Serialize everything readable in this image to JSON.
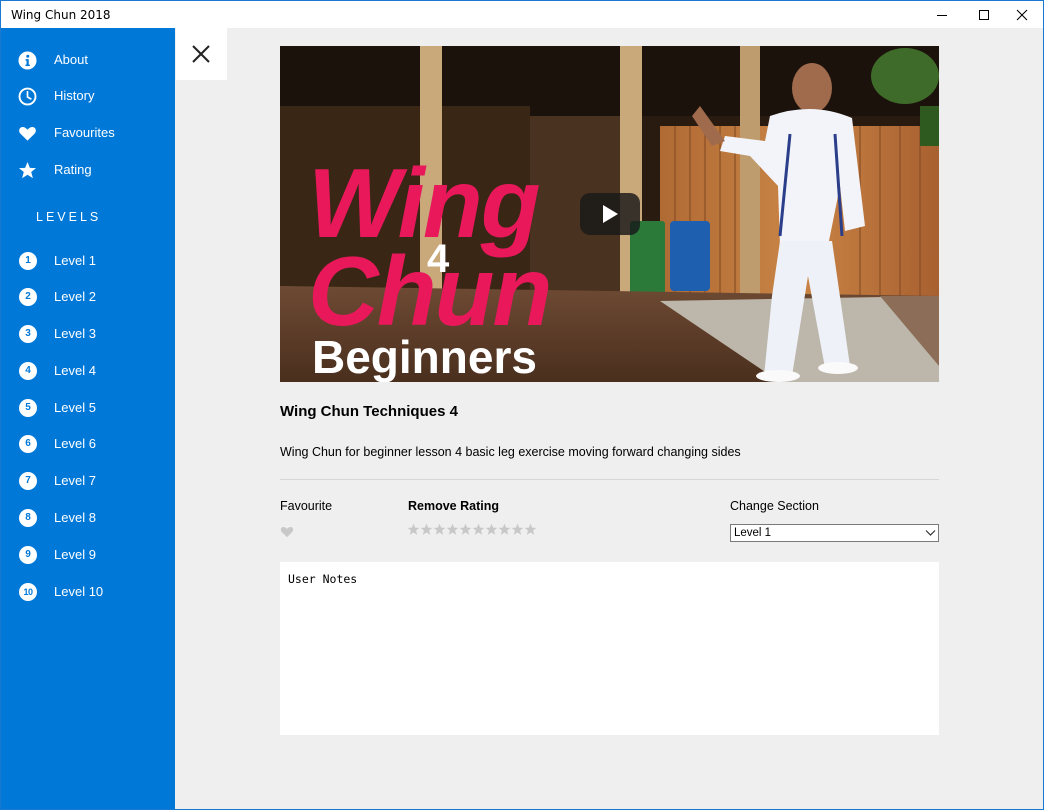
{
  "window": {
    "title": "Wing Chun 2018"
  },
  "sidebar": {
    "menu": [
      {
        "label": "About",
        "icon": "info-icon"
      },
      {
        "label": "History",
        "icon": "clock-icon"
      },
      {
        "label": "Favourites",
        "icon": "heart-icon"
      },
      {
        "label": "Rating",
        "icon": "star-icon"
      }
    ],
    "levels_header": "LEVELS",
    "levels": [
      {
        "num": "1",
        "label": "Level 1"
      },
      {
        "num": "2",
        "label": "Level 2"
      },
      {
        "num": "3",
        "label": "Level 3"
      },
      {
        "num": "4",
        "label": "Level 4"
      },
      {
        "num": "5",
        "label": "Level 5"
      },
      {
        "num": "6",
        "label": "Level 6"
      },
      {
        "num": "7",
        "label": "Level 7"
      },
      {
        "num": "8",
        "label": "Level 8"
      },
      {
        "num": "9",
        "label": "Level 9"
      },
      {
        "num": "10",
        "label": "Level 10"
      }
    ]
  },
  "video": {
    "thumbnail_text": {
      "line1": "Wing",
      "number": "4",
      "line2": "Chun",
      "line3": "Beginners"
    },
    "title": "Wing Chun Techniques 4",
    "description": "Wing Chun for beginner lesson 4 basic leg exercise moving forward changing sides"
  },
  "controls": {
    "favourite_label": "Favourite",
    "rating_label": "Remove Rating",
    "rating_value": 0,
    "rating_max": 10,
    "section_label": "Change Section",
    "section_value": "Level 1"
  },
  "notes": {
    "placeholder": "User Notes"
  },
  "colors": {
    "accent": "#0078d7",
    "thumbnail_title": "#e8185b",
    "inactive_icon": "#c8c8c8"
  }
}
